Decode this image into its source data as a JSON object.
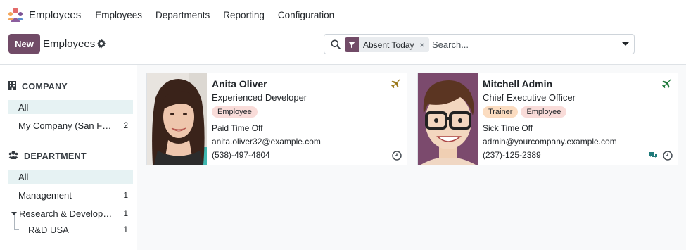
{
  "app": {
    "name": "Employees"
  },
  "nav": {
    "items": [
      "Employees",
      "Departments",
      "Reporting",
      "Configuration"
    ]
  },
  "control": {
    "new_label": "New",
    "title": "Employees",
    "facet_label": "Absent Today",
    "facet_remove": "×",
    "search_placeholder": "Search..."
  },
  "sidebar": {
    "company": {
      "heading": "COMPANY",
      "items": [
        {
          "label": "All",
          "count": ""
        },
        {
          "label": "My Company (San Francisco)",
          "count": "2"
        }
      ]
    },
    "department": {
      "heading": "DEPARTMENT",
      "items": [
        {
          "label": "All",
          "count": ""
        },
        {
          "label": "Management",
          "count": "1"
        },
        {
          "label": "Research & Development",
          "count": "1"
        },
        {
          "label": "R&D USA",
          "count": "1"
        }
      ]
    }
  },
  "cards": [
    {
      "name": "Anita Oliver",
      "job": "Experienced Developer",
      "tags": [
        "Employee"
      ],
      "leave": "Paid Time Off",
      "email": "anita.oliver32@example.com",
      "phone": "(538)-497-4804",
      "plane_color": "#9c7a1c"
    },
    {
      "name": "Mitchell Admin",
      "job": "Chief Executive Officer",
      "tags": [
        "Trainer",
        "Employee"
      ],
      "leave": "Sick Time Off",
      "email": "admin@yourcompany.example.com",
      "phone": "(237)-125-2389",
      "plane_color": "#1e7a3a"
    }
  ],
  "colors": {
    "brand": "#714b67",
    "active_filter": "#e6f2f3",
    "tag_employee": "#f9dcd9",
    "tag_trainer": "#fbdcc0"
  }
}
